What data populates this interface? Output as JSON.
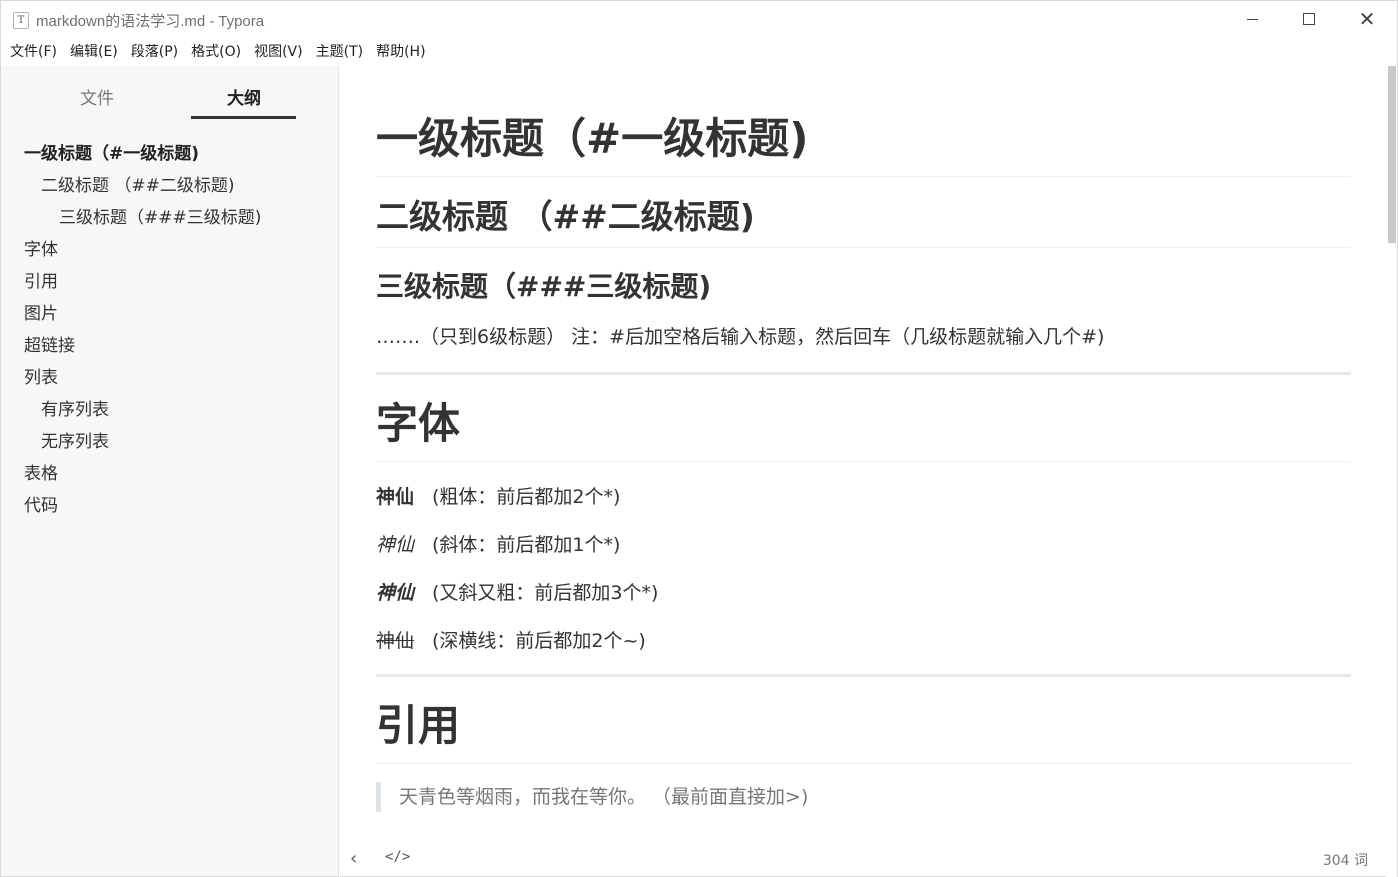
{
  "window": {
    "title": "markdown的语法学习.md - Typora",
    "app_icon_letter": "T",
    "minimize_icon": "minimize-icon",
    "maximize_icon": "maximize-icon",
    "close_icon": "close-icon",
    "close_glyph": "✕"
  },
  "menu": [
    {
      "label": "文件(F)"
    },
    {
      "label": "编辑(E)"
    },
    {
      "label": "段落(P)"
    },
    {
      "label": "格式(O)"
    },
    {
      "label": "视图(V)"
    },
    {
      "label": "主题(T)"
    },
    {
      "label": "帮助(H)"
    }
  ],
  "sidebar": {
    "tabs": {
      "files": "文件",
      "outline": "大纲"
    },
    "active_tab": "outline",
    "outline": [
      {
        "label": "一级标题（#一级标题)",
        "level": 1,
        "active": true
      },
      {
        "label": "二级标题 （##二级标题)",
        "level": 2
      },
      {
        "label": "三级标题（###三级标题)",
        "level": 3
      },
      {
        "label": "字体",
        "level": 1
      },
      {
        "label": "引用",
        "level": 1
      },
      {
        "label": "图片",
        "level": 1
      },
      {
        "label": "超链接",
        "level": 1
      },
      {
        "label": "列表",
        "level": 1
      },
      {
        "label": "有序列表",
        "level": 2
      },
      {
        "label": "无序列表",
        "level": 2
      },
      {
        "label": "表格",
        "level": 1
      },
      {
        "label": "代码",
        "level": 1
      }
    ]
  },
  "document": {
    "h1_title": "一级标题（#一级标题)",
    "h2_title": "二级标题 （##二级标题)",
    "h3_title": "三级标题（###三级标题)",
    "heading_note": "…….（只到6级标题） 注：#后加空格后输入标题，然后回车（几级标题就输入几个#)",
    "font_section": {
      "heading": "字体",
      "lines": [
        {
          "sample": "神仙",
          "note": "(粗体：前后都加2个*)"
        },
        {
          "sample": "神仙",
          "note": "(斜体：前后都加1个*)"
        },
        {
          "sample": "神仙",
          "note": "(又斜又粗：前后都加3个*)"
        },
        {
          "sample": "神仙",
          "note": "(深横线：前后都加2个~)"
        }
      ]
    },
    "quote_section": {
      "heading": "引用",
      "quote_text": "天青色等烟雨，而我在等你。 （最前面直接加>)"
    }
  },
  "statusbar": {
    "back_glyph": "‹",
    "back_icon": "chevron-left-icon",
    "code_glyph": "</>",
    "code_icon": "source-code-icon",
    "word_count": "304 词"
  },
  "colors": {
    "sidebar_bg": "#f7f7f7",
    "text": "#333333",
    "quote_border": "#dfe2e5",
    "hr": "#e7e7e7"
  }
}
